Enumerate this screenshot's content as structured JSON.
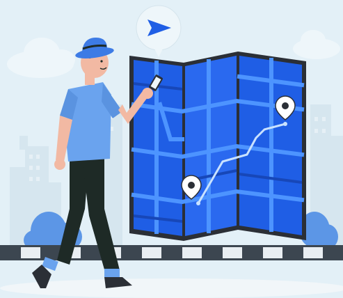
{
  "illustration": {
    "subject": "person-walking-with-phone-and-map",
    "icons": [
      "navigation-arrow-icon",
      "location-pin-icon",
      "smartphone-icon"
    ]
  },
  "colors": {
    "sky": "#e3f0f7",
    "city": "#d9e9f2",
    "cloud": "#eef6fa",
    "map_blue": "#1f5ee5",
    "map_dark": "#2b2f36",
    "road_light": "#5aa6ff",
    "route": "#c9e2ff",
    "shirt": "#6aa3ee",
    "pants": "#1e2a26",
    "skin": "#f2b9a3",
    "hat": "#3d7be5",
    "bush": "#5c96e6",
    "fence_dark": "#3c4650",
    "fence_light": "#e9eef2",
    "ground": "#f3f7f9"
  }
}
